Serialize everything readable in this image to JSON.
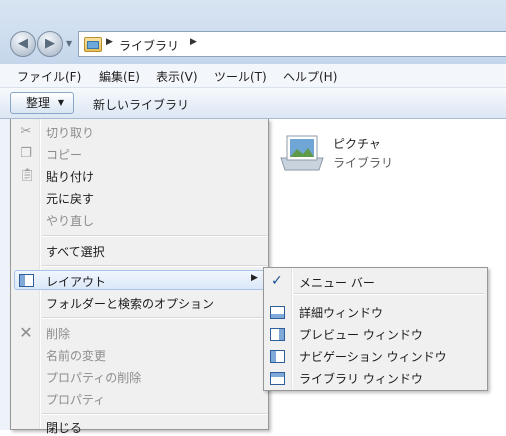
{
  "address": {
    "crumb": "ライブラリ"
  },
  "menubar": {
    "items": [
      "ファイル(F)",
      "編集(E)",
      "表示(V)",
      "ツール(T)",
      "ヘルプ(H)"
    ]
  },
  "toolbar": {
    "organize_label": "整理",
    "new_library_label": "新しいライブラリ"
  },
  "content": {
    "item_name": "ピクチャ",
    "item_type": "ライブラリ"
  },
  "organize_menu": {
    "cut": "切り取り",
    "copy": "コピー",
    "paste": "貼り付け",
    "undo": "元に戻す",
    "redo": "やり直し",
    "select_all": "すべて選択",
    "layout": "レイアウト",
    "folder_options": "フォルダーと検索のオプション",
    "delete": "削除",
    "rename": "名前の変更",
    "remove_properties": "プロパティの削除",
    "properties": "プロパティ",
    "close": "閉じる"
  },
  "layout_submenu": {
    "menu_bar": "メニュー バー",
    "details_pane": "詳細ウィンドウ",
    "preview_pane": "プレビュー ウィンドウ",
    "navigation_pane": "ナビゲーション ウィンドウ",
    "library_pane": "ライブラリ ウィンドウ"
  },
  "colors": {
    "chrome": "#cfdeef",
    "highlight": "#dbe8f8",
    "check": "#1b4f94"
  }
}
